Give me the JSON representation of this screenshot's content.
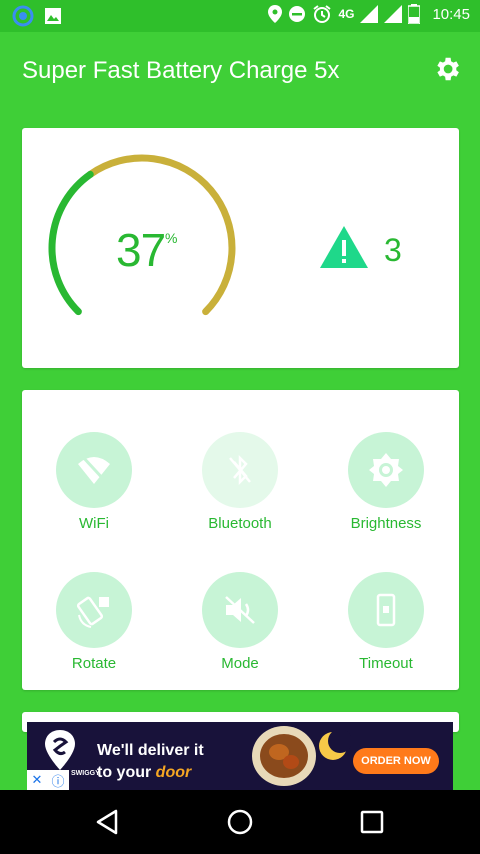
{
  "status_bar": {
    "time": "10:45",
    "network": "4G",
    "icons": [
      "sync-icon",
      "image-icon",
      "location-icon",
      "dnd-icon",
      "alarm-icon",
      "signal-icon",
      "signal-icon",
      "battery-icon"
    ]
  },
  "app": {
    "title": "Super Fast Battery Charge 5x",
    "settings_icon": "gear-icon"
  },
  "battery": {
    "percent": 37,
    "percent_text": "37",
    "percent_sign": "%",
    "warning_count": "3",
    "gauge_colors": {
      "charged": "#29b832",
      "remaining": "#c9b03a"
    }
  },
  "tiles": [
    {
      "label": "WiFi",
      "icon": "wifi-off-icon",
      "faded": false
    },
    {
      "label": "Bluetooth",
      "icon": "bluetooth-off-icon",
      "faded": true
    },
    {
      "label": "Brightness",
      "icon": "brightness-icon",
      "faded": false
    },
    {
      "label": "Rotate",
      "icon": "rotate-icon",
      "faded": false
    },
    {
      "label": "Mode",
      "icon": "volume-off-icon",
      "faded": false
    },
    {
      "label": "Timeout",
      "icon": "phone-timeout-icon",
      "faded": false
    }
  ],
  "ad": {
    "line1": "We'll deliver it",
    "line2_prefix": "to your ",
    "line2_emph": "door",
    "cta": "ORDER NOW",
    "brand": "SWIGGY"
  },
  "colors": {
    "background": "#3fcf37",
    "status_bar": "#2fbf2b",
    "accent": "#29b832",
    "tile_bg": "#c7f4d6",
    "warning": "#1fd88a"
  }
}
